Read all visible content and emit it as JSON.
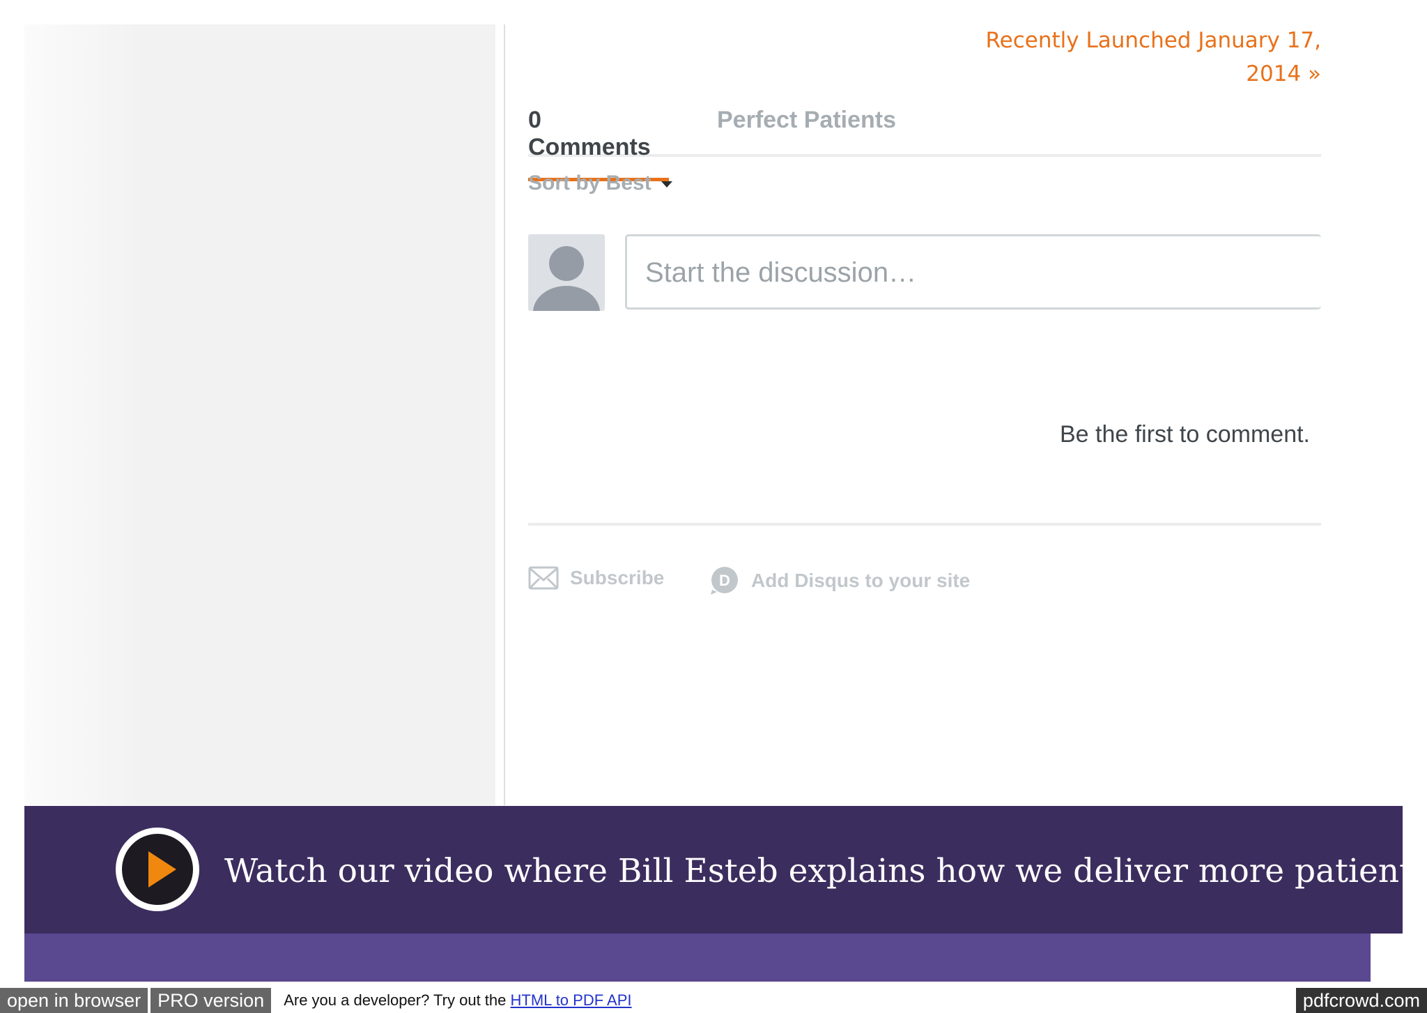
{
  "post_nav": {
    "next_post": "Recently Launched January 17, 2014 »"
  },
  "comments": {
    "tabs": [
      {
        "label": "0 Comments"
      },
      {
        "label": "Perfect Patients"
      }
    ],
    "sort_label": "Sort by Best",
    "input_placeholder": "Start the discussion…",
    "empty_message": "Be the first to comment.",
    "footer": {
      "subscribe_label": "Subscribe",
      "add_disqus_label": "Add Disqus to your site"
    }
  },
  "video_banner": {
    "text": "Watch our video where Bill Esteb explains how we deliver more patients."
  },
  "pdfcrowd": {
    "open_label": "open in browser",
    "pro_label": "PRO version",
    "message": "Are you a developer? Try out the",
    "api_link": "HTML to PDF API",
    "brand": "pdfcrowd.com"
  },
  "colors": {
    "accent": "#e8711a",
    "banner": "#3c2d5f",
    "banner_strip": "#5a4890",
    "muted_text": "#a6adb2"
  },
  "icons": {
    "subscribe": "envelope-icon",
    "disqus": "disqus-logo-icon",
    "play": "play-icon",
    "sort_caret": "caret-down-icon",
    "avatar": "user-silhouette-icon"
  }
}
